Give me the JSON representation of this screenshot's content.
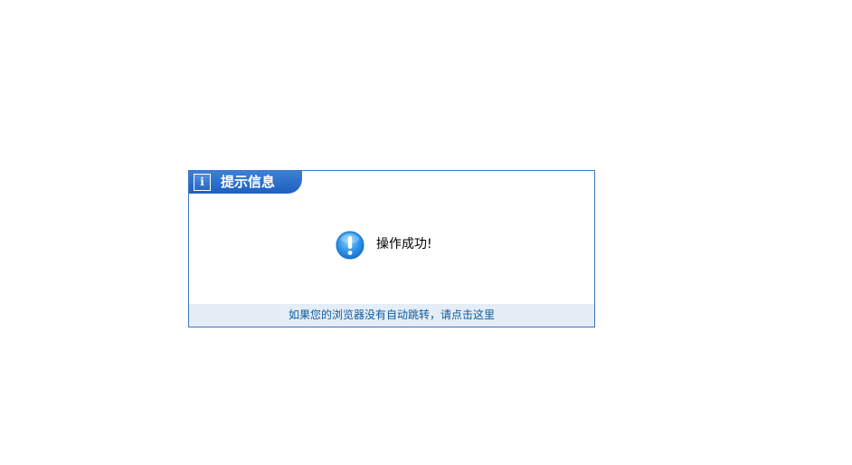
{
  "dialog": {
    "title": "提示信息",
    "header_icon": "info-icon",
    "message": "操作成功!",
    "message_icon": "exclamation-icon",
    "redirect_link": "如果您的浏览器没有自动跳转，请点击这里",
    "colors": {
      "border": "#3d74c5",
      "header": "#2a6fcb",
      "footer_bg": "#e5edf6",
      "link": "#0b5b9f"
    }
  }
}
